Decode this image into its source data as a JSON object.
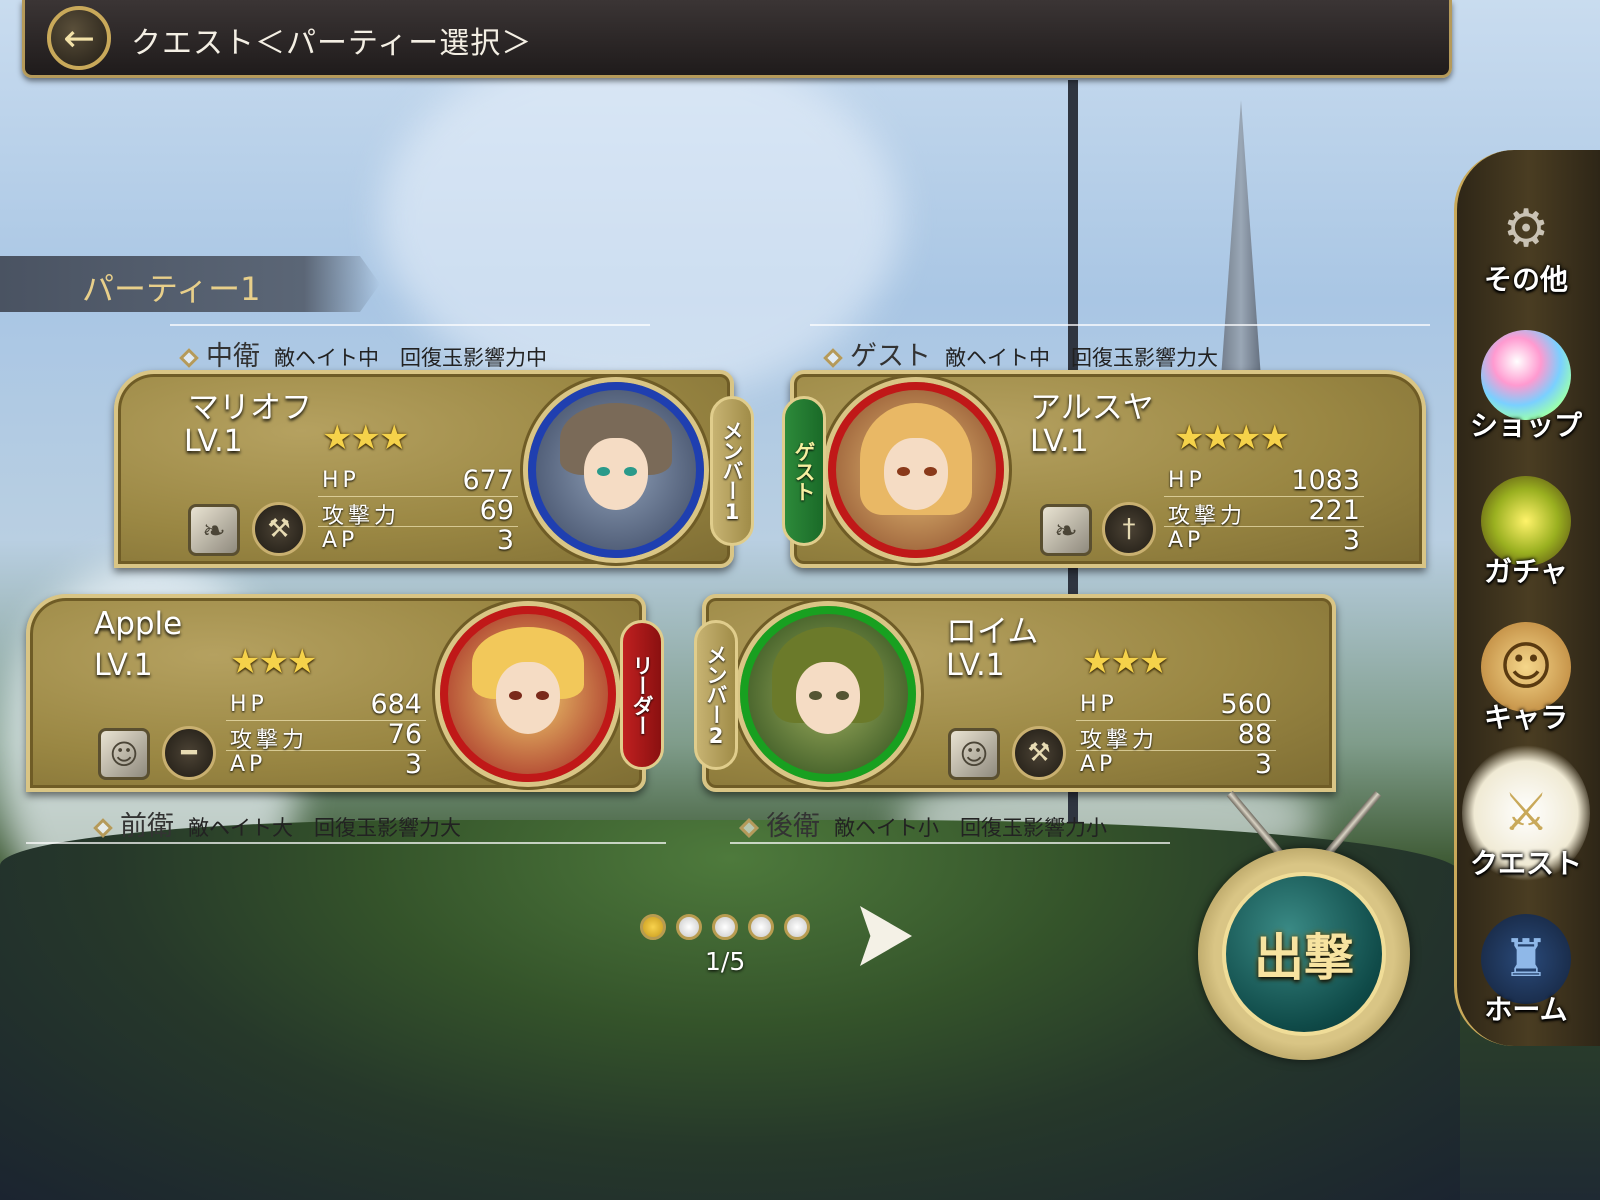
{
  "header": {
    "title": "クエスト＜パーティー選択＞",
    "back_icon": "back-arrow-icon"
  },
  "party": {
    "name": "パーティー1"
  },
  "positions": {
    "mid": {
      "role": "中衛",
      "desc": "敵ヘイト中　回復玉影響力中"
    },
    "guest": {
      "role": "ゲスト",
      "desc": "敵ヘイト中　回復玉影響力大"
    },
    "front": {
      "role": "前衛",
      "desc": "敵ヘイト大　回復玉影響力大"
    },
    "back": {
      "role": "後衛",
      "desc": "敵ヘイト小　回復玉影響力小"
    }
  },
  "stat_labels": {
    "hp": "HP",
    "atk": "攻撃力",
    "ap": "AP"
  },
  "members": [
    {
      "slot": "メンバー1",
      "name": "マリオフ",
      "level": "LV.1",
      "stars": 3,
      "hp": "677",
      "atk": "69",
      "ap": "3",
      "frame_color": "#1f3fb0",
      "weapon": "axe-icon",
      "skill": "wing-icon"
    },
    {
      "slot": "ゲスト",
      "name": "アルスヤ",
      "level": "LV.1",
      "stars": 4,
      "hp": "1083",
      "atk": "221",
      "ap": "3",
      "frame_color": "#c01818",
      "weapon": "dagger-icon",
      "skill": "wing-icon"
    },
    {
      "slot": "リーダー",
      "name": "Apple",
      "level": "LV.1",
      "stars": 3,
      "hp": "684",
      "atk": "76",
      "ap": "3",
      "frame_color": "#c01818",
      "weapon": "gun-icon",
      "skill": "character-icon"
    },
    {
      "slot": "メンバー2",
      "name": "ロイム",
      "level": "LV.1",
      "stars": 3,
      "hp": "560",
      "atk": "88",
      "ap": "3",
      "frame_color": "#18a020",
      "weapon": "hammer-icon",
      "skill": "character-icon"
    }
  ],
  "pager": {
    "text": "1/5",
    "total": 5,
    "active": 1
  },
  "sortie": {
    "label": "出撃"
  },
  "side_menu": [
    {
      "label": "その他",
      "icon": "gear-icon"
    },
    {
      "label": "ショップ",
      "icon": "rainbow-orb-icon"
    },
    {
      "label": "ガチャ",
      "icon": "treasure-chest-icon"
    },
    {
      "label": "キャラ",
      "icon": "character-icon"
    },
    {
      "label": "クエスト",
      "icon": "crossed-swords-icon"
    },
    {
      "label": "ホーム",
      "icon": "castle-icon"
    }
  ],
  "colors": {
    "gold": "#d9c585",
    "card": "#9a8743",
    "accent": "#f5d24a"
  }
}
